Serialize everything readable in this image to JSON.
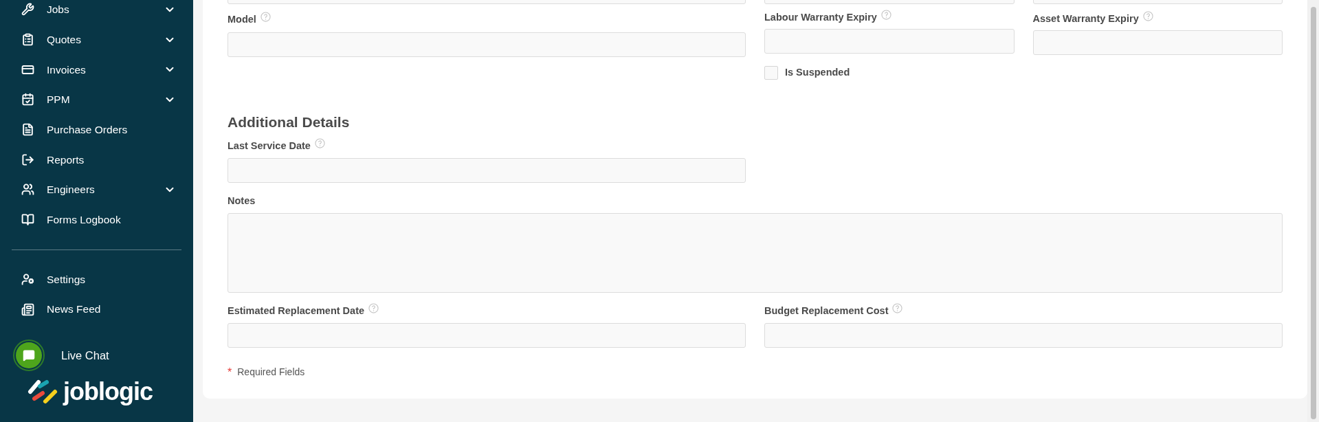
{
  "sidebar": {
    "items": [
      {
        "label": "Jobs",
        "expandable": true
      },
      {
        "label": "Quotes",
        "expandable": true
      },
      {
        "label": "Invoices",
        "expandable": true
      },
      {
        "label": "PPM",
        "expandable": true
      },
      {
        "label": "Purchase Orders",
        "expandable": false
      },
      {
        "label": "Reports",
        "expandable": false
      },
      {
        "label": "Engineers",
        "expandable": true
      },
      {
        "label": "Forms Logbook",
        "expandable": false
      }
    ],
    "footer_items": [
      {
        "label": "Settings"
      },
      {
        "label": "News Feed"
      }
    ],
    "live_chat": {
      "label": "Live Chat"
    },
    "logo": {
      "text": "joblogic"
    }
  },
  "form": {
    "row1": [
      {
        "label": "Model",
        "help": true
      },
      {
        "label": "Labour Warranty Expiry",
        "help": true
      },
      {
        "label": "Asset Warranty Expiry",
        "help": true
      }
    ],
    "checkbox": {
      "label": "Is Suspended",
      "checked": false
    },
    "section_title": "Additional Details",
    "fields": [
      {
        "label": "Last Service Date",
        "help": true,
        "kind": "input"
      },
      {
        "label": "Notes",
        "help": false,
        "kind": "textarea"
      },
      {
        "label": "Estimated Replacement Date",
        "help": true,
        "kind": "input"
      },
      {
        "label": "Budget Replacement Cost",
        "help": true,
        "kind": "input"
      }
    ],
    "required_note": {
      "mark": "*",
      "text": "Required Fields"
    }
  }
}
